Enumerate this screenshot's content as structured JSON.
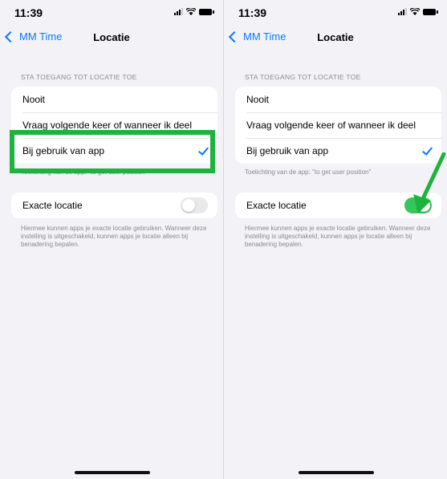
{
  "screens": [
    {
      "time": "11:39",
      "back_label": "MM Time",
      "title": "Locatie",
      "section_header": "STA TOEGANG TOT LOCATIE TOE",
      "options": [
        {
          "label": "Nooit"
        },
        {
          "label": "Vraag volgende keer of wanneer ik deel"
        },
        {
          "label": "Bij gebruik van app",
          "selected": true
        }
      ],
      "explanation": "Toelichting van de app: \"to get user position\"",
      "precise_label": "Exacte locatie",
      "precise_on": false,
      "precise_note": "Hiermee kunnen apps je exacte locatie gebruiken. Wanneer deze instelling is uitgeschakeld, kunnen apps je locatie alleen bij benadering bepalen."
    },
    {
      "time": "11:39",
      "back_label": "MM Time",
      "title": "Locatie",
      "section_header": "STA TOEGANG TOT LOCATIE TOE",
      "options": [
        {
          "label": "Nooit"
        },
        {
          "label": "Vraag volgende keer of wanneer ik deel"
        },
        {
          "label": "Bij gebruik van app",
          "selected": true
        }
      ],
      "explanation": "Toelichting van de app: \"to get user position\"",
      "precise_label": "Exacte locatie",
      "precise_on": true,
      "precise_note": "Hiermee kunnen apps je exacte locatie gebruiken. Wanneer deze instelling is uitgeschakeld, kunnen apps je locatie alleen bij benadering bepalen."
    }
  ],
  "colors": {
    "accent": "#0a7aff",
    "toggle_on": "#34c759",
    "annotation": "#1db33d"
  }
}
